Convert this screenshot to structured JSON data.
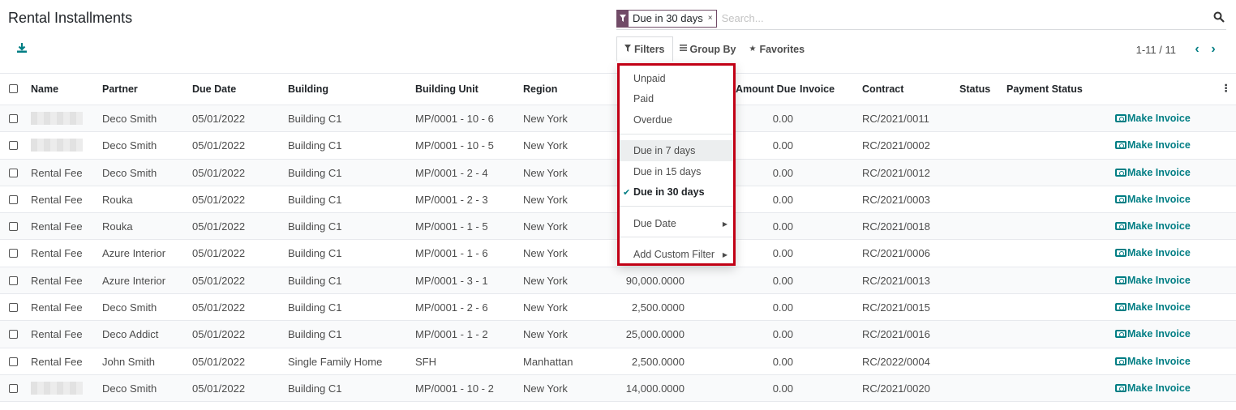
{
  "header": {
    "title": "Rental Installments"
  },
  "search": {
    "facet_value": "Due in 30 days",
    "facet_close": "×",
    "placeholder": "Search..."
  },
  "toolbar": {
    "filters": "Filters",
    "group_by": "Group By",
    "favorites": "Favorites"
  },
  "pager": {
    "value": "1-11 / 11",
    "prev": "‹",
    "next": "›"
  },
  "columns": {
    "name": "Name",
    "partner": "Partner",
    "due_date": "Due Date",
    "building": "Building",
    "building_unit": "Building Unit",
    "region": "Region",
    "amount_due": "Amount Due",
    "invoice": "Invoice",
    "contract": "Contract",
    "status": "Status",
    "payment_status": "Payment Status"
  },
  "rows": [
    {
      "name": "",
      "partner": "Deco Smith",
      "due_date": "05/01/2022",
      "building": "Building C1",
      "unit": "MP/0001 - 10 - 6",
      "region": "New York",
      "amount": "",
      "amount_due": "0.00",
      "contract": "RC/2021/0011",
      "action": "Make Invoice"
    },
    {
      "name": "",
      "partner": "Deco Smith",
      "due_date": "05/01/2022",
      "building": "Building C1",
      "unit": "MP/0001 - 10 - 5",
      "region": "New York",
      "amount": "",
      "amount_due": "0.00",
      "contract": "RC/2021/0002",
      "action": "Make Invoice"
    },
    {
      "name": "Rental Fee",
      "partner": "Deco Smith",
      "due_date": "05/01/2022",
      "building": "Building C1",
      "unit": "MP/0001 - 2 - 4",
      "region": "New York",
      "amount": "",
      "amount_due": "0.00",
      "contract": "RC/2021/0012",
      "action": "Make Invoice"
    },
    {
      "name": "Rental Fee",
      "partner": "Rouka",
      "due_date": "05/01/2022",
      "building": "Building C1",
      "unit": "MP/0001 - 2 - 3",
      "region": "New York",
      "amount": "",
      "amount_due": "0.00",
      "contract": "RC/2021/0003",
      "action": "Make Invoice"
    },
    {
      "name": "Rental Fee",
      "partner": "Rouka",
      "due_date": "05/01/2022",
      "building": "Building C1",
      "unit": "MP/0001 - 1 - 5",
      "region": "New York",
      "amount": "",
      "amount_due": "0.00",
      "contract": "RC/2021/0018",
      "action": "Make Invoice"
    },
    {
      "name": "Rental Fee",
      "partner": "Azure Interior",
      "due_date": "05/01/2022",
      "building": "Building C1",
      "unit": "MP/0001 - 1 - 6",
      "region": "New York",
      "amount": "",
      "amount_due": "0.00",
      "contract": "RC/2021/0006",
      "action": "Make Invoice"
    },
    {
      "name": "Rental Fee",
      "partner": "Azure Interior",
      "due_date": "05/01/2022",
      "building": "Building C1",
      "unit": "MP/0001 - 3 - 1",
      "region": "New York",
      "amount": "90,000.0000",
      "amount_due": "0.00",
      "contract": "RC/2021/0013",
      "action": "Make Invoice"
    },
    {
      "name": "Rental Fee",
      "partner": "Deco Smith",
      "due_date": "05/01/2022",
      "building": "Building C1",
      "unit": "MP/0001 - 2 - 6",
      "region": "New York",
      "amount": "2,500.0000",
      "amount_due": "0.00",
      "contract": "RC/2021/0015",
      "action": "Make Invoice"
    },
    {
      "name": "Rental Fee",
      "partner": "Deco Addict",
      "due_date": "05/01/2022",
      "building": "Building C1",
      "unit": "MP/0001 - 1 - 2",
      "region": "New York",
      "amount": "25,000.0000",
      "amount_due": "0.00",
      "contract": "RC/2021/0016",
      "action": "Make Invoice"
    },
    {
      "name": "Rental Fee",
      "partner": "John Smith",
      "due_date": "05/01/2022",
      "building": "Single Family Home",
      "unit": "SFH",
      "region": "Manhattan",
      "amount": "2,500.0000",
      "amount_due": "0.00",
      "contract": "RC/2022/0004",
      "action": "Make Invoice"
    },
    {
      "name": "",
      "partner": "Deco Smith",
      "due_date": "05/01/2022",
      "building": "Building C1",
      "unit": "MP/0001 - 10 - 2",
      "region": "New York",
      "amount": "14,000.0000",
      "amount_due": "0.00",
      "contract": "RC/2021/0020",
      "action": "Make Invoice"
    }
  ],
  "filters_menu": {
    "unpaid": "Unpaid",
    "paid": "Paid",
    "overdue": "Overdue",
    "due7": "Due in 7 days",
    "due15": "Due in 15 days",
    "due30": "Due in 30 days",
    "due_date": "Due Date",
    "custom": "Add Custom Filter"
  },
  "colors": {
    "accent": "#017e84",
    "brand": "#714b67",
    "highlight_border": "#c10015"
  }
}
